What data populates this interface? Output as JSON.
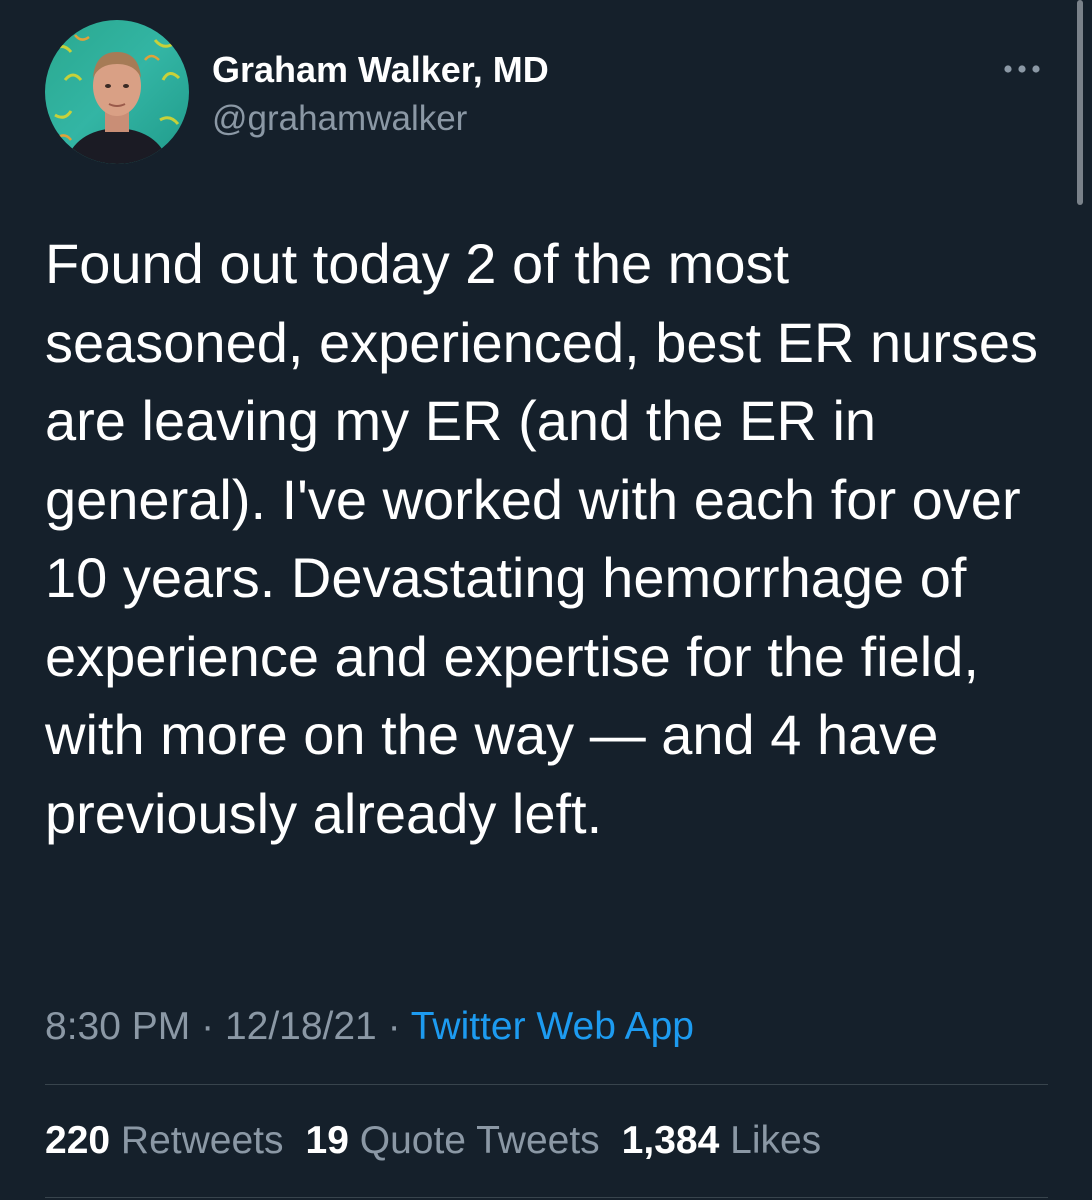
{
  "author": {
    "name": "Graham Walker, MD",
    "handle": "@grahamwalker"
  },
  "tweet": {
    "text": "Found out today 2 of the most seasoned, experienced, best ER nurses are leaving my ER (and the ER in general). I've worked with each for over 10 years. Devastating hemorrhage of experience and expertise for the field, with more on the way — and 4 have previously already left.",
    "time": "8:30 PM",
    "separator": "·",
    "date": "12/18/21",
    "source": "Twitter Web App"
  },
  "stats": {
    "retweets": {
      "count": "220",
      "label": "Retweets"
    },
    "quote_tweets": {
      "count": "19",
      "label": "Quote Tweets"
    },
    "likes": {
      "count": "1,384",
      "label": "Likes"
    }
  },
  "icons": {
    "more": "more-horizontal-icon"
  },
  "colors": {
    "background": "#15202b",
    "primary_text": "#ffffff",
    "secondary_text": "#8b98a5",
    "accent": "#1d9bf0",
    "divider": "#38444d"
  }
}
